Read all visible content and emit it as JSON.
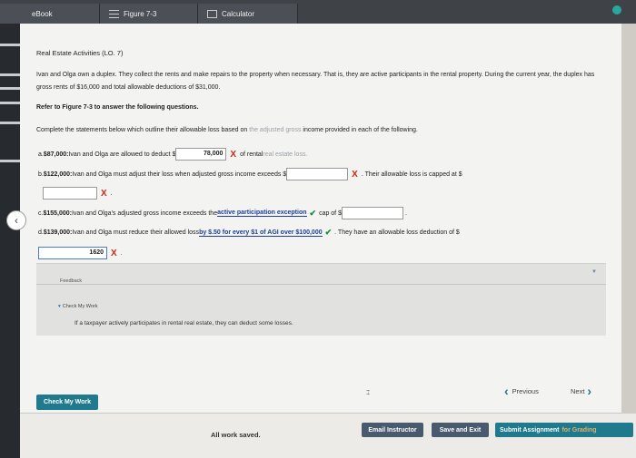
{
  "tabs": [
    {
      "label": "eBook"
    },
    {
      "label": "Figure 7-3"
    },
    {
      "label": "Calculator"
    }
  ],
  "content": {
    "title": "Real Estate Activities (LO. 7)",
    "intro": "Ivan and Olga own a duplex. They collect the rents and make repairs to the property when necessary. That is, they are active participants in the rental property. During the current year, the duplex has gross rents of $16,000 and total allowable deductions of $31,000.",
    "refer": "Refer to Figure 7-3 to answer the following questions.",
    "instr_pre": "Complete the statements below which outline their allowable loss based on ",
    "instr_muted": "the adjusted gross",
    "instr_post": " income provided in each of the following.",
    "qa": {
      "prefix": "a. ",
      "amount": "$87,000:",
      "text": " Ivan and Olga are allowed to deduct $",
      "value": "78,000",
      "mark": "X",
      "after": " of rental ",
      "after_muted": "real estate loss."
    },
    "qb": {
      "prefix": "b. ",
      "amount": "$122,000:",
      "text": " Ivan and Olga must adjust their loss when adjusted gross income exceeds $",
      "value": "",
      "mark": "X",
      "after": ". Their allowable loss is capped at $",
      "value2": "",
      "mark2": "X",
      "end": "."
    },
    "qc": {
      "prefix": "c. ",
      "amount": "$155,000:",
      "text": " Ivan and Olga's adjusted gross income exceeds the ",
      "select": "active participation exception",
      "check": "✔",
      "after": " cap of $",
      "value": "",
      "end": "."
    },
    "qd": {
      "prefix": "d. ",
      "amount": "$139,000:",
      "text": " Ivan and Olga must reduce their allowed loss ",
      "select": "by $.50 for every $1 of AGI over $100,000",
      "check": "✔",
      "after": ". They have an allowable loss deduction of $",
      "value": "1620",
      "mark": "X",
      "end": "."
    }
  },
  "feedback": {
    "label": "Feedback",
    "check_my_work": "Check My Work",
    "message": "If a taxpayer actively participates in rental real estate, they can deduct some losses.",
    "arrow": "▼"
  },
  "nav": {
    "check_my_work_button": "Check My Work",
    "previous": "Previous",
    "next": "Next"
  },
  "bottom": {
    "saved": "All work saved.",
    "email": "Email Instructor",
    "save_exit": "Save and Exit",
    "submit": "Submit Assignment",
    "submit_faded": "for Grading"
  },
  "colors": {
    "accent": "#1e7a8c",
    "error": "#d2271b",
    "correct": "#1a8a3c",
    "select_text": "#1d3f97"
  }
}
